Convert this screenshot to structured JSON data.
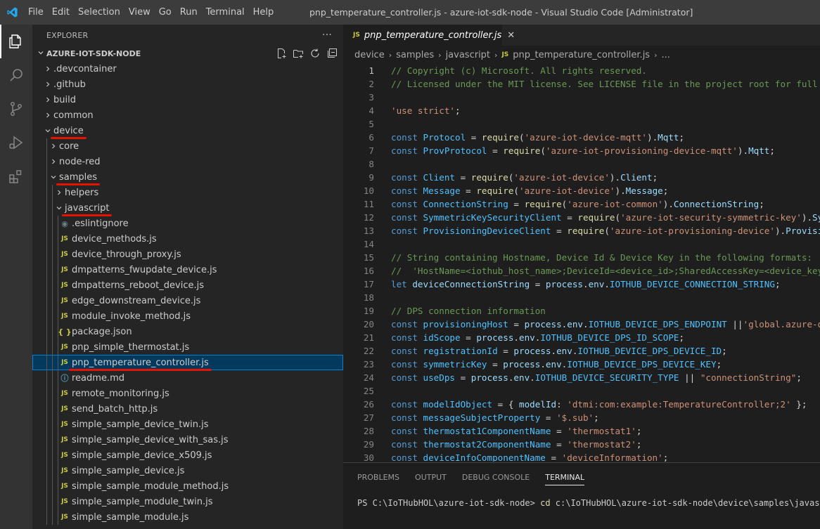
{
  "window": {
    "title": "pnp_temperature_controller.js - azure-iot-sdk-node - Visual Studio Code [Administrator]",
    "menu": [
      "File",
      "Edit",
      "Selection",
      "View",
      "Go",
      "Run",
      "Terminal",
      "Help"
    ]
  },
  "activity_bar": [
    "explorer-icon",
    "search-icon",
    "source-control-icon",
    "run-debug-icon",
    "extensions-icon"
  ],
  "sidebar": {
    "header": "EXPLORER",
    "more": "···",
    "section": "AZURE-IOT-SDK-NODE",
    "tree": [
      {
        "label": ".devcontainer",
        "type": "folder",
        "depth": 0,
        "expanded": false
      },
      {
        "label": ".github",
        "type": "folder",
        "depth": 0,
        "expanded": false
      },
      {
        "label": "build",
        "type": "folder",
        "depth": 0,
        "expanded": false
      },
      {
        "label": "common",
        "type": "folder",
        "depth": 0,
        "expanded": false
      },
      {
        "label": "device",
        "type": "folder",
        "depth": 0,
        "expanded": true
      },
      {
        "label": "core",
        "type": "folder",
        "depth": 1,
        "expanded": false
      },
      {
        "label": "node-red",
        "type": "folder",
        "depth": 1,
        "expanded": false
      },
      {
        "label": "samples",
        "type": "folder",
        "depth": 1,
        "expanded": true
      },
      {
        "label": "helpers",
        "type": "folder",
        "depth": 2,
        "expanded": false
      },
      {
        "label": "javascript",
        "type": "folder",
        "depth": 2,
        "expanded": true
      },
      {
        "label": ".eslintignore",
        "type": "dot",
        "depth": 3
      },
      {
        "label": "device_methods.js",
        "type": "js",
        "depth": 3
      },
      {
        "label": "device_through_proxy.js",
        "type": "js",
        "depth": 3
      },
      {
        "label": "dmpatterns_fwupdate_device.js",
        "type": "js",
        "depth": 3
      },
      {
        "label": "dmpatterns_reboot_device.js",
        "type": "js",
        "depth": 3
      },
      {
        "label": "edge_downstream_device.js",
        "type": "js",
        "depth": 3
      },
      {
        "label": "module_invoke_method.js",
        "type": "js",
        "depth": 3
      },
      {
        "label": "package.json",
        "type": "json",
        "depth": 3
      },
      {
        "label": "pnp_simple_thermostat.js",
        "type": "js",
        "depth": 3
      },
      {
        "label": "pnp_temperature_controller.js",
        "type": "js",
        "depth": 3,
        "selected": true
      },
      {
        "label": "readme.md",
        "type": "info",
        "depth": 3
      },
      {
        "label": "remote_monitoring.js",
        "type": "js",
        "depth": 3
      },
      {
        "label": "send_batch_http.js",
        "type": "js",
        "depth": 3
      },
      {
        "label": "simple_sample_device_twin.js",
        "type": "js",
        "depth": 3
      },
      {
        "label": "simple_sample_device_with_sas.js",
        "type": "js",
        "depth": 3
      },
      {
        "label": "simple_sample_device_x509.js",
        "type": "js",
        "depth": 3
      },
      {
        "label": "simple_sample_device.js",
        "type": "js",
        "depth": 3
      },
      {
        "label": "simple_sample_module_method.js",
        "type": "js",
        "depth": 3
      },
      {
        "label": "simple_sample_module_twin.js",
        "type": "js",
        "depth": 3
      },
      {
        "label": "simple_sample_module.js",
        "type": "js",
        "depth": 3
      }
    ],
    "icon_labels": {
      "js": "JS",
      "json": "{ }",
      "info": "ⓘ",
      "dot": "◉"
    },
    "highlight_color": "#e51400"
  },
  "editor": {
    "tab": {
      "icon": "JS",
      "label": "pnp_temperature_controller.js",
      "close": "✕"
    },
    "breadcrumb": [
      "device",
      "samples",
      "javascript",
      "pnp_temperature_controller.js",
      "..."
    ],
    "current_line": 1,
    "lines": [
      [
        [
          "c",
          "// Copyright (c) Microsoft. All rights reserved."
        ]
      ],
      [
        [
          "c",
          "// Licensed under the MIT license. See LICENSE file in the project root for full license information."
        ]
      ],
      [],
      [
        [
          "s",
          "'use strict'"
        ],
        [
          "p",
          ";"
        ]
      ],
      [],
      [
        [
          "k",
          "const "
        ],
        [
          "v",
          "Protocol"
        ],
        [
          "p",
          " = "
        ],
        [
          "f",
          "require"
        ],
        [
          "p",
          "("
        ],
        [
          "s",
          "'azure-iot-device-mqtt'"
        ],
        [
          "p",
          ")."
        ],
        [
          "r",
          "Mqtt"
        ],
        [
          "p",
          ";"
        ]
      ],
      [
        [
          "k",
          "const "
        ],
        [
          "v",
          "ProvProtocol"
        ],
        [
          "p",
          " = "
        ],
        [
          "f",
          "require"
        ],
        [
          "p",
          "("
        ],
        [
          "s",
          "'azure-iot-provisioning-device-mqtt'"
        ],
        [
          "p",
          ")."
        ],
        [
          "r",
          "Mqtt"
        ],
        [
          "p",
          ";"
        ]
      ],
      [],
      [
        [
          "k",
          "const "
        ],
        [
          "v",
          "Client"
        ],
        [
          "p",
          " = "
        ],
        [
          "f",
          "require"
        ],
        [
          "p",
          "("
        ],
        [
          "s",
          "'azure-iot-device'"
        ],
        [
          "p",
          ")."
        ],
        [
          "r",
          "Client"
        ],
        [
          "p",
          ";"
        ]
      ],
      [
        [
          "k",
          "const "
        ],
        [
          "v",
          "Message"
        ],
        [
          "p",
          " = "
        ],
        [
          "f",
          "require"
        ],
        [
          "p",
          "("
        ],
        [
          "s",
          "'azure-iot-device'"
        ],
        [
          "p",
          ")."
        ],
        [
          "r",
          "Message"
        ],
        [
          "p",
          ";"
        ]
      ],
      [
        [
          "k",
          "const "
        ],
        [
          "v",
          "ConnectionString"
        ],
        [
          "p",
          " = "
        ],
        [
          "f",
          "require"
        ],
        [
          "p",
          "("
        ],
        [
          "s",
          "'azure-iot-common'"
        ],
        [
          "p",
          ")."
        ],
        [
          "r",
          "ConnectionString"
        ],
        [
          "p",
          ";"
        ]
      ],
      [
        [
          "k",
          "const "
        ],
        [
          "v",
          "SymmetricKeySecurityClient"
        ],
        [
          "p",
          " = "
        ],
        [
          "f",
          "require"
        ],
        [
          "p",
          "("
        ],
        [
          "s",
          "'azure-iot-security-symmetric-key'"
        ],
        [
          "p",
          ")."
        ],
        [
          "r",
          "SymmetricKeySecurityClient"
        ],
        [
          "p",
          ";"
        ]
      ],
      [
        [
          "k",
          "const "
        ],
        [
          "v",
          "ProvisioningDeviceClient"
        ],
        [
          "p",
          " = "
        ],
        [
          "f",
          "require"
        ],
        [
          "p",
          "("
        ],
        [
          "s",
          "'azure-iot-provisioning-device'"
        ],
        [
          "p",
          ")."
        ],
        [
          "r",
          "ProvisioningDeviceClient"
        ],
        [
          "p",
          ";"
        ]
      ],
      [],
      [
        [
          "c",
          "// String containing Hostname, Device Id & Device Key in the following formats:"
        ]
      ],
      [
        [
          "c",
          "//  'HostName=<iothub_host_name>;DeviceId=<device_id>;SharedAccessKey=<device_key>'"
        ]
      ],
      [
        [
          "k",
          "let "
        ],
        [
          "r",
          "deviceConnectionString"
        ],
        [
          "p",
          " = "
        ],
        [
          "r",
          "process"
        ],
        [
          "p",
          "."
        ],
        [
          "r",
          "env"
        ],
        [
          "p",
          "."
        ],
        [
          "v",
          "IOTHUB_DEVICE_CONNECTION_STRING"
        ],
        [
          "p",
          ";"
        ]
      ],
      [],
      [
        [
          "c",
          "// DPS connection information"
        ]
      ],
      [
        [
          "k",
          "const "
        ],
        [
          "v",
          "provisioningHost"
        ],
        [
          "p",
          " = "
        ],
        [
          "r",
          "process"
        ],
        [
          "p",
          "."
        ],
        [
          "r",
          "env"
        ],
        [
          "p",
          "."
        ],
        [
          "v",
          "IOTHUB_DEVICE_DPS_ENDPOINT"
        ],
        [
          "p",
          " ||"
        ],
        [
          "s",
          "'global.azure-devices-provisioning.net'"
        ],
        [
          "p",
          ";"
        ]
      ],
      [
        [
          "k",
          "const "
        ],
        [
          "v",
          "idScope"
        ],
        [
          "p",
          " = "
        ],
        [
          "r",
          "process"
        ],
        [
          "p",
          "."
        ],
        [
          "r",
          "env"
        ],
        [
          "p",
          "."
        ],
        [
          "v",
          "IOTHUB_DEVICE_DPS_ID_SCOPE"
        ],
        [
          "p",
          ";"
        ]
      ],
      [
        [
          "k",
          "const "
        ],
        [
          "v",
          "registrationId"
        ],
        [
          "p",
          " = "
        ],
        [
          "r",
          "process"
        ],
        [
          "p",
          "."
        ],
        [
          "r",
          "env"
        ],
        [
          "p",
          "."
        ],
        [
          "v",
          "IOTHUB_DEVICE_DPS_DEVICE_ID"
        ],
        [
          "p",
          ";"
        ]
      ],
      [
        [
          "k",
          "const "
        ],
        [
          "v",
          "symmetricKey"
        ],
        [
          "p",
          " = "
        ],
        [
          "r",
          "process"
        ],
        [
          "p",
          "."
        ],
        [
          "r",
          "env"
        ],
        [
          "p",
          "."
        ],
        [
          "v",
          "IOTHUB_DEVICE_DPS_DEVICE_KEY"
        ],
        [
          "p",
          ";"
        ]
      ],
      [
        [
          "k",
          "const "
        ],
        [
          "v",
          "useDps"
        ],
        [
          "p",
          " = "
        ],
        [
          "r",
          "process"
        ],
        [
          "p",
          "."
        ],
        [
          "r",
          "env"
        ],
        [
          "p",
          "."
        ],
        [
          "v",
          "IOTHUB_DEVICE_SECURITY_TYPE"
        ],
        [
          "p",
          " || "
        ],
        [
          "s",
          "\"connectionString\""
        ],
        [
          "p",
          ";"
        ]
      ],
      [],
      [
        [
          "k",
          "const "
        ],
        [
          "v",
          "modelIdObject"
        ],
        [
          "p",
          " = { "
        ],
        [
          "r",
          "modelId"
        ],
        [
          "p",
          ": "
        ],
        [
          "s",
          "'dtmi:com:example:TemperatureController;2'"
        ],
        [
          "p",
          " };"
        ]
      ],
      [
        [
          "k",
          "const "
        ],
        [
          "v",
          "messageSubjectProperty"
        ],
        [
          "p",
          " = "
        ],
        [
          "s",
          "'$.sub'"
        ],
        [
          "p",
          ";"
        ]
      ],
      [
        [
          "k",
          "const "
        ],
        [
          "v",
          "thermostat1ComponentName"
        ],
        [
          "p",
          " = "
        ],
        [
          "s",
          "'thermostat1'"
        ],
        [
          "p",
          ";"
        ]
      ],
      [
        [
          "k",
          "const "
        ],
        [
          "v",
          "thermostat2ComponentName"
        ],
        [
          "p",
          " = "
        ],
        [
          "s",
          "'thermostat2'"
        ],
        [
          "p",
          ";"
        ]
      ],
      [
        [
          "k",
          "const "
        ],
        [
          "v",
          "deviceInfoComponentName"
        ],
        [
          "p",
          " = "
        ],
        [
          "s",
          "'deviceInformation'"
        ],
        [
          "p",
          ";"
        ]
      ]
    ]
  },
  "panel": {
    "tabs": [
      "PROBLEMS",
      "OUTPUT",
      "DEBUG CONSOLE",
      "TERMINAL"
    ],
    "active_tab": "TERMINAL",
    "terminal": {
      "prompt": "PS C:\\IoTHubHOL\\azure-iot-sdk-node> ",
      "command": "cd",
      "args": " c:\\IoTHubHOL\\azure-iot-sdk-node\\device\\samples\\javascript"
    }
  },
  "colors": {
    "titlebar": "#3c3c3c",
    "activitybar": "#333333",
    "sidebar": "#252526",
    "editor": "#1e1e1e",
    "selection": "#04395e",
    "accent": "#007acc"
  }
}
